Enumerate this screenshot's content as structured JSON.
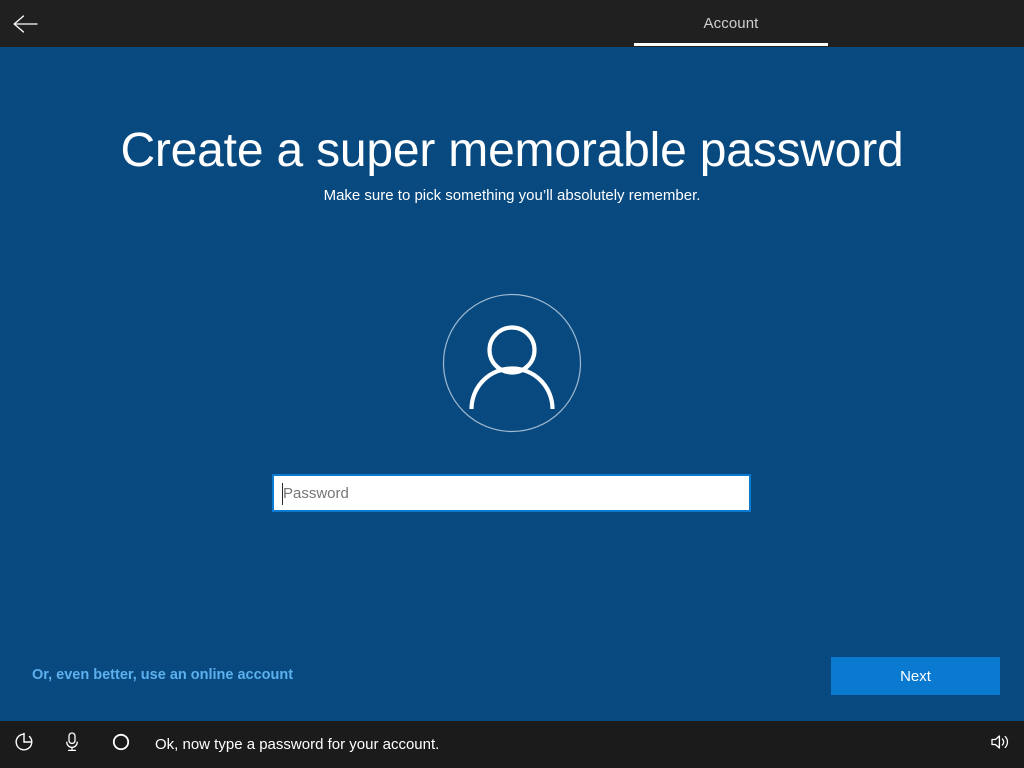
{
  "header": {
    "back_icon": "back-arrow-icon",
    "tab_label": "Account"
  },
  "main": {
    "title": "Create a super memorable password",
    "subtitle": "Make sure to pick something you’ll absolutely remember.",
    "avatar_icon": "person-avatar-icon",
    "password": {
      "value": "",
      "placeholder": "Password"
    },
    "online_account_link": "Or, even better, use an online account",
    "next_label": "Next"
  },
  "taskbar": {
    "ease_of_access_icon": "ease-of-access-icon",
    "microphone_icon": "microphone-icon",
    "cortana_icon": "cortana-circle-icon",
    "narrator_text": "Ok, now type a password for your account.",
    "volume_icon": "speaker-volume-icon"
  },
  "colors": {
    "background_blue": "#084a80",
    "header_dark": "#202020",
    "taskbar_dark": "#1b1b1b",
    "accent_blue": "#0a7ad1",
    "link_blue": "#5cb0ee",
    "text_white": "#ffffff",
    "placeholder_gray": "#767676"
  }
}
